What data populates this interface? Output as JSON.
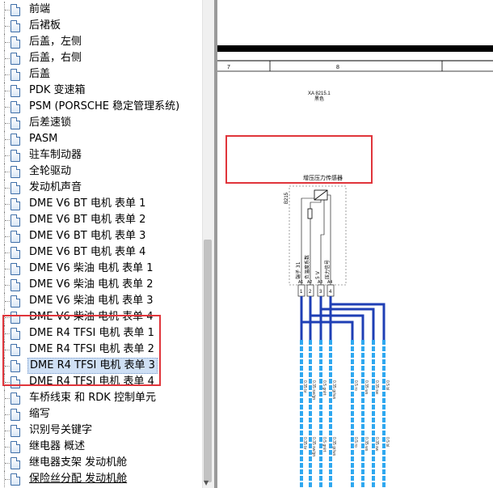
{
  "tree": {
    "items": [
      {
        "label": "前端"
      },
      {
        "label": "后裙板"
      },
      {
        "label": "后盖，左侧"
      },
      {
        "label": "后盖，右侧"
      },
      {
        "label": "后盖"
      },
      {
        "label": "PDK 变速箱"
      },
      {
        "label": "PSM (PORSCHE 稳定管理系统)"
      },
      {
        "label": "后差速锁"
      },
      {
        "label": "PASM"
      },
      {
        "label": "驻车制动器"
      },
      {
        "label": "全轮驱动"
      },
      {
        "label": "发动机声音"
      },
      {
        "label": "DME V6 BT 电机 表单 1"
      },
      {
        "label": "DME V6 BT 电机 表单 2"
      },
      {
        "label": "DME V6 BT 电机 表单 3"
      },
      {
        "label": "DME V6 BT 电机 表单 4"
      },
      {
        "label": "DME V6 柴油 电机 表单 1"
      },
      {
        "label": "DME V6 柴油 电机 表单 2"
      },
      {
        "label": "DME V6 柴油 电机 表单 3"
      },
      {
        "label": "DME V6 柴油 电机 表单 4"
      },
      {
        "label": "DME R4 TFSI 电机 表单 1"
      },
      {
        "label": "DME R4 TFSI 电机 表单 2"
      },
      {
        "label": "DME R4 TFSI 电机 表单 3",
        "selected": true
      },
      {
        "label": "DME R4 TFSI 电机 表单 4"
      },
      {
        "label": "车桥线束 和 RDK 控制单元"
      },
      {
        "label": "缩写"
      },
      {
        "label": "识别号关键字"
      },
      {
        "label": "继电器 概述"
      },
      {
        "label": "继电器支架 发动机舱"
      },
      {
        "label": "保险丝分配 发动机舱",
        "link": true
      }
    ]
  },
  "diagram": {
    "col_left": "7",
    "col_right": "8",
    "component_id": "XA 8215.1",
    "component_sub": "黑色",
    "component_name": "增压压力传感器",
    "component_code": "B215",
    "pins": [
      "1",
      "2",
      "3",
      "4"
    ],
    "pin_labels": [
      "端子 31",
      "负温度系数",
      "5 V",
      "压力信号"
    ],
    "connector_a": [
      "A1",
      "A2",
      "A3",
      "A4"
    ],
    "wire_labels": [
      "0.35 br",
      "0.35 sw/gn",
      "0.5 gn/rt",
      "0.35 gr/ws",
      "0.5 ro",
      "0.35 ws",
      "0.35 sw",
      "0.5 bl"
    ]
  },
  "colors": {
    "highlight": "#e0353b",
    "wire_blue": "#1f3fb5",
    "wire_light": "#2fa8f0"
  }
}
